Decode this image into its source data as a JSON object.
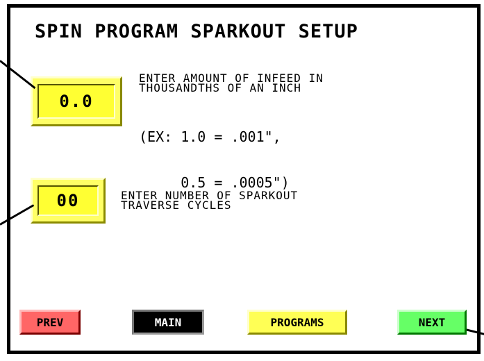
{
  "screen": {
    "title": "SPIN PROGRAM SPARKOUT SETUP"
  },
  "infeed": {
    "value": "0.0",
    "description_line1": "ENTER AMOUNT OF INFEED IN",
    "description_line2": "THOUSANDTHS OF AN INCH",
    "example_line1": "(EX: 1.0 = .001\",",
    "example_line2": "     0.5 = .0005\")"
  },
  "sparkout_cycles": {
    "value": "00",
    "description_line1": "ENTER NUMBER OF SPARKOUT",
    "description_line2": "TRAVERSE CYCLES"
  },
  "nav": {
    "prev_label": "PREV",
    "main_label": "MAIN",
    "programs_label": "PROGRAMS",
    "next_label": "NEXT"
  },
  "colors": {
    "field": "#ffff66",
    "prev": "#ff6666",
    "main": "#000000",
    "programs": "#ffff55",
    "next": "#66ff66"
  }
}
